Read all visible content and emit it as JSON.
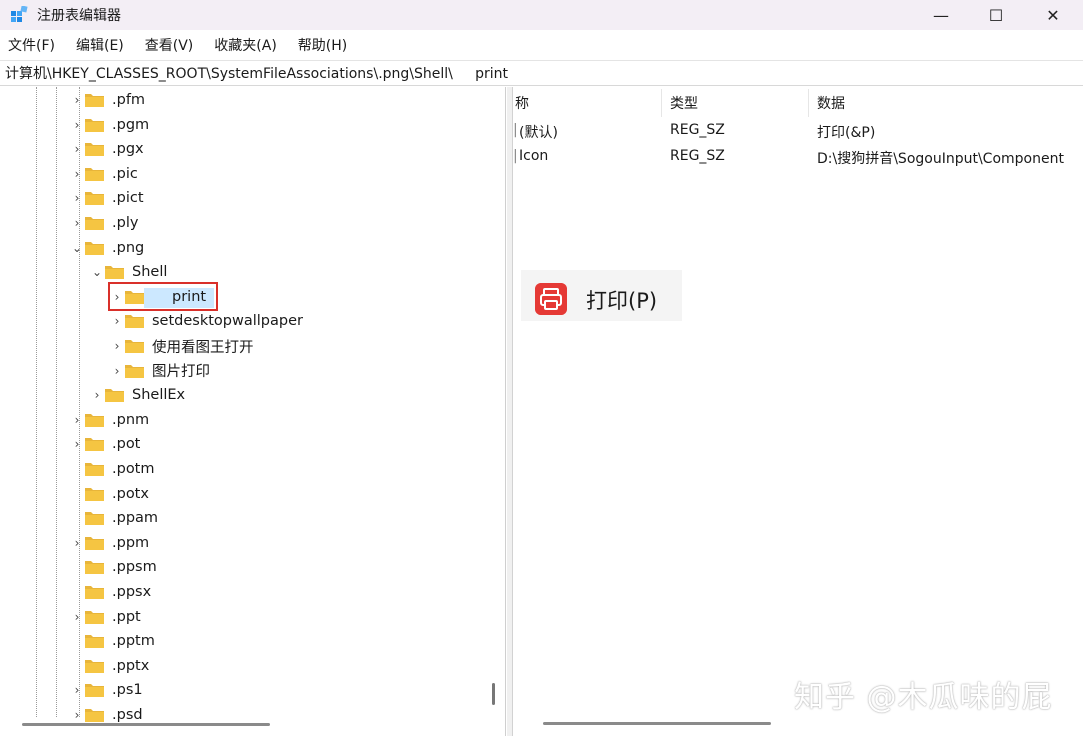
{
  "window": {
    "title": "注册表编辑器",
    "minimize_glyph": "—",
    "maximize_glyph": "☐",
    "close_glyph": "✕"
  },
  "menu": [
    "文件(F)",
    "编辑(E)",
    "查看(V)",
    "收藏夹(A)",
    "帮助(H)"
  ],
  "address": "计算机\\HKEY_CLASSES_ROOT\\SystemFileAssociations\\.png\\Shell\\     print",
  "tree": {
    "nodes": [
      {
        "label": ".pfm",
        "chevron": "›"
      },
      {
        "label": ".pgm",
        "chevron": "›"
      },
      {
        "label": ".pgx",
        "chevron": "›"
      },
      {
        "label": ".pic",
        "chevron": "›"
      },
      {
        "label": ".pict",
        "chevron": "›"
      },
      {
        "label": ".ply",
        "chevron": "›"
      },
      {
        "label": ".png",
        "chevron": "⌄"
      },
      {
        "label": "Shell",
        "chevron": "⌄"
      },
      {
        "label": "print",
        "chevron": "›"
      },
      {
        "label": "setdesktopwallpaper",
        "chevron": "›"
      },
      {
        "label": "使用看图王打开",
        "chevron": "›"
      },
      {
        "label": "图片打印",
        "chevron": "›"
      },
      {
        "label": "ShellEx",
        "chevron": "›"
      },
      {
        "label": ".pnm",
        "chevron": "›"
      },
      {
        "label": ".pot",
        "chevron": "›"
      },
      {
        "label": ".potm",
        "chevron": ""
      },
      {
        "label": ".potx",
        "chevron": ""
      },
      {
        "label": ".ppam",
        "chevron": ""
      },
      {
        "label": ".ppm",
        "chevron": "›"
      },
      {
        "label": ".ppsm",
        "chevron": ""
      },
      {
        "label": ".ppsx",
        "chevron": ""
      },
      {
        "label": ".ppt",
        "chevron": "›"
      },
      {
        "label": ".pptm",
        "chevron": ""
      },
      {
        "label": ".pptx",
        "chevron": ""
      },
      {
        "label": ".ps1",
        "chevron": "›"
      },
      {
        "label": ".psd",
        "chevron": "›"
      }
    ]
  },
  "values": {
    "headers": [
      "称",
      "类型",
      "数据"
    ],
    "rows": [
      {
        "name": "(默认)",
        "type": "REG_SZ",
        "data": "打印(&P)"
      },
      {
        "name": "Icon",
        "type": "REG_SZ",
        "data": "D:\\搜狗拼音\\SogouInput\\Component"
      }
    ]
  },
  "context_menu": {
    "label": "打印(P)",
    "icon": "printer-icon"
  },
  "watermark": "知乎 @木瓜味的屁",
  "colors": {
    "selection": "#cce8ff",
    "highlight_border": "#d9302a",
    "folder": "#f5c542",
    "print_icon": "#e53935"
  }
}
